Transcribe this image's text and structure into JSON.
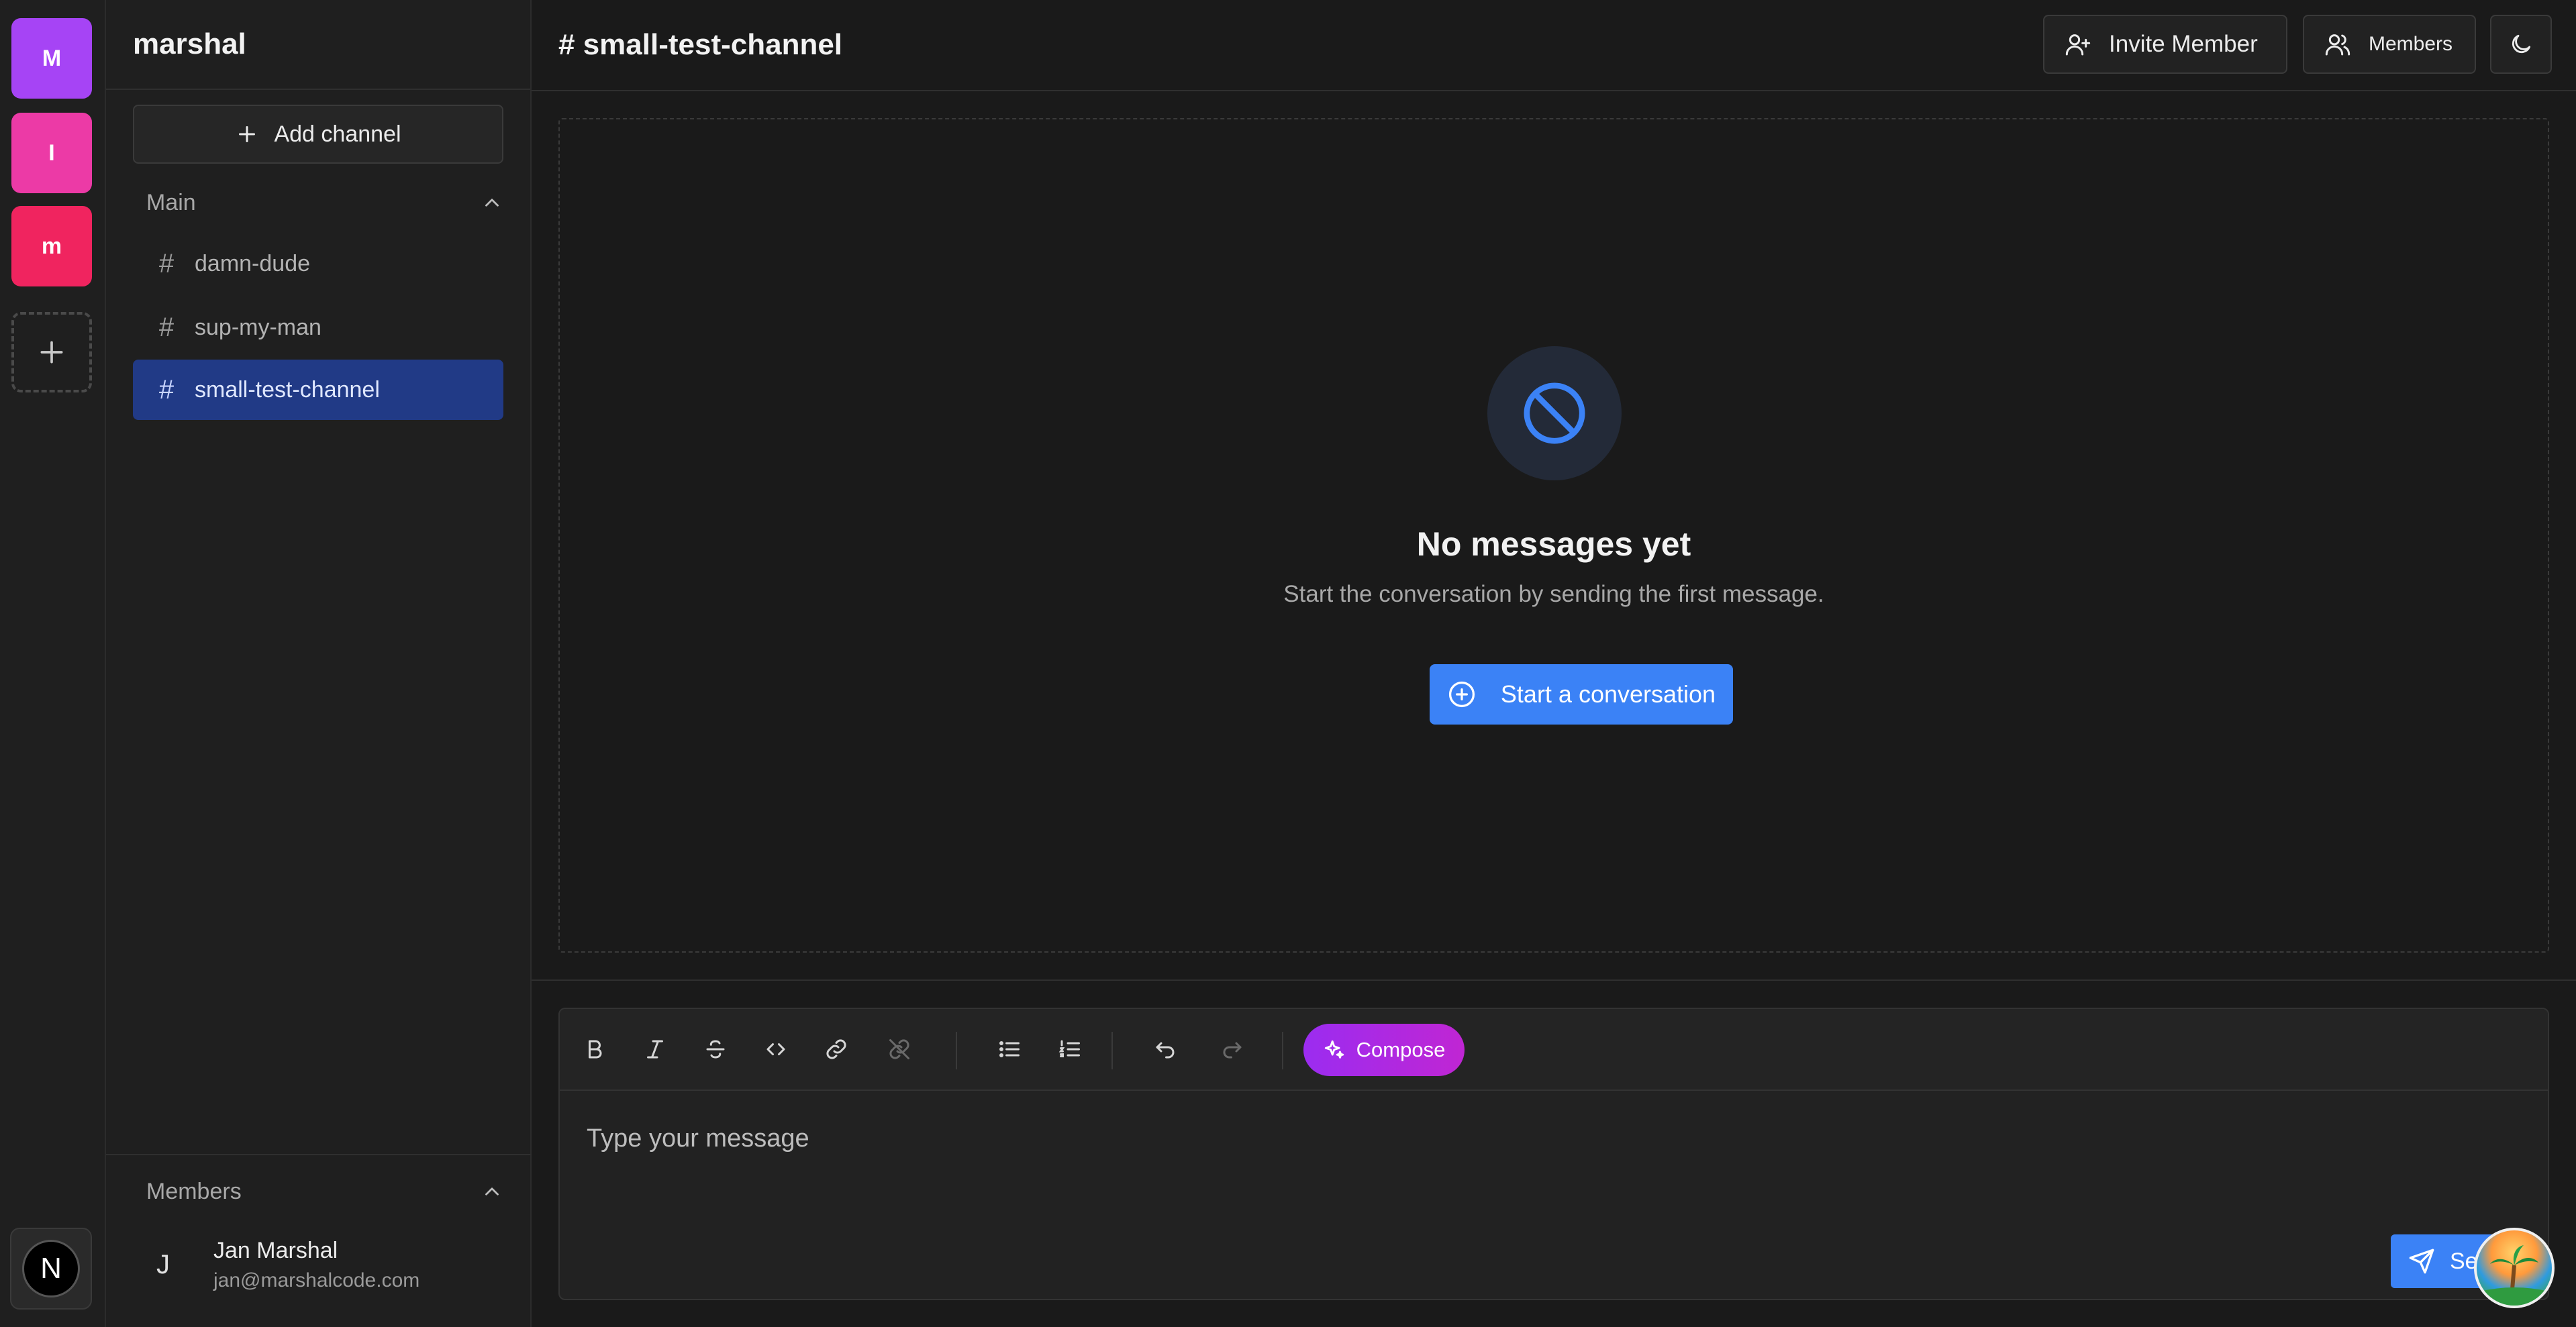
{
  "servers": [
    {
      "letter": "M",
      "color": "#a644f5"
    },
    {
      "letter": "I",
      "color": "#ec3aa6"
    },
    {
      "letter": "m",
      "color": "#f0245f"
    }
  ],
  "rail": {
    "add_server_icon": "plus-icon",
    "app_badge_letter": "N"
  },
  "sidebar": {
    "workspace_name": "marshal",
    "add_channel_label": "Add channel",
    "sections": {
      "main_label": "Main",
      "members_label": "Members"
    },
    "channels": [
      {
        "name": "damn-dude",
        "active": false
      },
      {
        "name": "sup-my-man",
        "active": false
      },
      {
        "name": "small-test-channel",
        "active": true
      }
    ],
    "members": [
      {
        "initial": "J",
        "name": "Jan Marshal",
        "email": "jan@marshalcode.com"
      }
    ]
  },
  "header": {
    "channel_title": "# small-test-channel",
    "invite_label": "Invite Member",
    "members_label": "Members",
    "theme_icon": "moon-icon"
  },
  "empty_state": {
    "icon": "ban-icon",
    "title": "No messages yet",
    "subtitle": "Start the conversation by sending the first message.",
    "cta_label": "Start a conversation"
  },
  "composer": {
    "toolbar": [
      "bold-icon",
      "italic-icon",
      "strikethrough-icon",
      "code-icon",
      "link-icon",
      "unlink-icon",
      "bullet-list-icon",
      "numbered-list-icon",
      "undo-icon",
      "redo-icon"
    ],
    "compose_label": "Compose",
    "placeholder": "Type your message",
    "send_label": "Send"
  },
  "colors": {
    "accent": "#3b82f6",
    "active_channel": "#213a86",
    "compose_gradient_start": "#9b2cf0",
    "compose_gradient_end": "#c026d3"
  }
}
